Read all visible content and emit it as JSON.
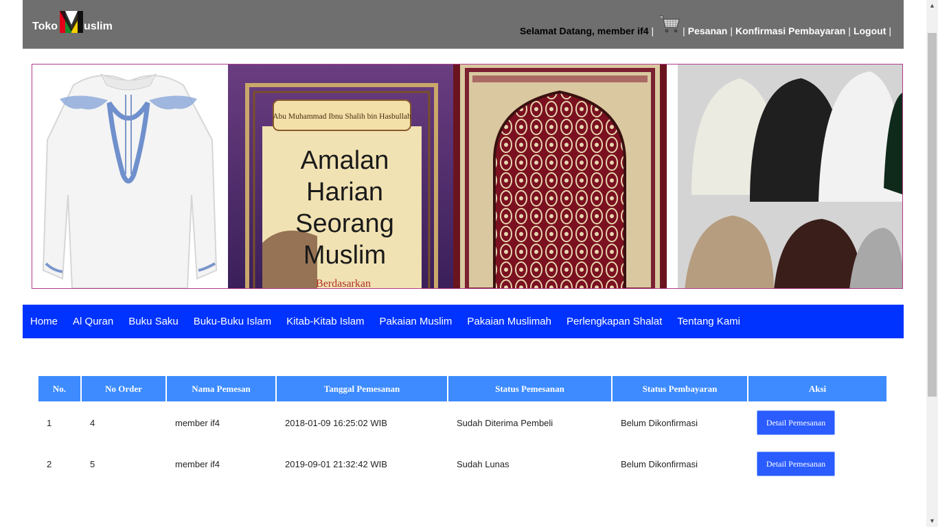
{
  "header": {
    "logo_left": "Toko",
    "logo_right": "uslim",
    "welcome": "Selamat Datang, member if4",
    "links": [
      "Pesanan",
      "Konfirmasi Pembayaran",
      "Logout"
    ]
  },
  "banner": {
    "book_author": "Abu Muhammad Ibnu Shalih bin Hasbullah",
    "book_title_lines": [
      "Amalan",
      "Harian",
      "Seorang",
      "Muslim"
    ],
    "book_subtitle": "Berdasarkan"
  },
  "menu": [
    "Home",
    "Al Quran",
    "Buku Saku",
    "Buku-Buku Islam",
    "Kitab-Kitab Islam",
    "Pakaian Muslim",
    "Pakaian Muslimah",
    "Perlengkapan Shalat",
    "Tentang Kami"
  ],
  "table": {
    "headers": [
      "No.",
      "No Order",
      "Nama Pemesan",
      "Tanggal Pemesanan",
      "Status Pemesanan",
      "Status Pembayaran",
      "Aksi"
    ],
    "rows": [
      {
        "no": "1",
        "order": "4",
        "name": "member if4",
        "date": "2018-01-09 16:25:02 WIB",
        "status": "Sudah Diterima Pembeli",
        "payment": "Belum Dikonfirmasi",
        "action": "Detail Pemesanan"
      },
      {
        "no": "2",
        "order": "5",
        "name": "member if4",
        "date": "2019-09-01 21:32:42 WIB",
        "status": "Sudah Lunas",
        "payment": "Belum Dikonfirmasi",
        "action": "Detail Pemesanan"
      }
    ]
  },
  "colors": {
    "header_bg": "#6f6f6f",
    "menu_bg": "#0033ff",
    "table_header": "#3d8bff",
    "button": "#2a5cff"
  },
  "icons": [
    "logo-m-icon",
    "cart-icon",
    "scroll-up-icon",
    "scroll-down-icon"
  ]
}
